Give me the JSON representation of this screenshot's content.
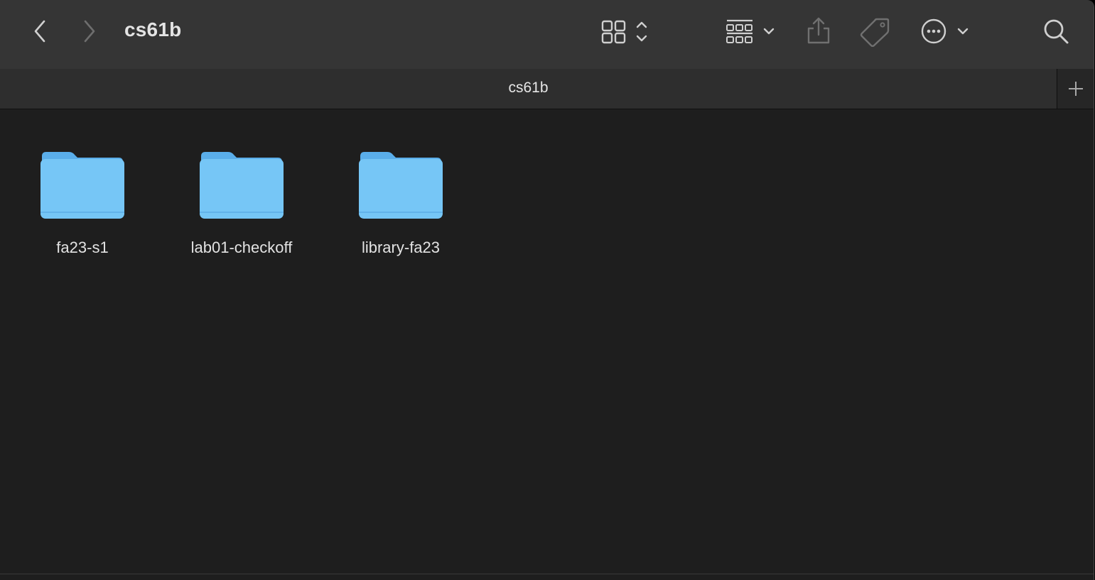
{
  "window": {
    "title": "cs61b"
  },
  "toolbar": {
    "back_icon": "chevron-left-icon",
    "forward_icon": "chevron-right-icon",
    "view_icon": "icon-grid-view-icon",
    "group_icon": "group-by-icon",
    "share_icon": "share-icon",
    "tag_icon": "tag-icon",
    "more_icon": "ellipsis-circle-icon",
    "search_icon": "search-icon"
  },
  "tabbar": {
    "active_tab": "cs61b",
    "add_icon": "plus-icon"
  },
  "items": [
    {
      "name": "fa23-s1",
      "kind": "folder"
    },
    {
      "name": "lab01-checkoff",
      "kind": "folder"
    },
    {
      "name": "library-fa23",
      "kind": "folder"
    }
  ],
  "colors": {
    "folder_body": "#76c6f6",
    "folder_tab": "#5aaeea",
    "toolbar_bg": "#353535",
    "content_bg": "#1e1e1e"
  }
}
